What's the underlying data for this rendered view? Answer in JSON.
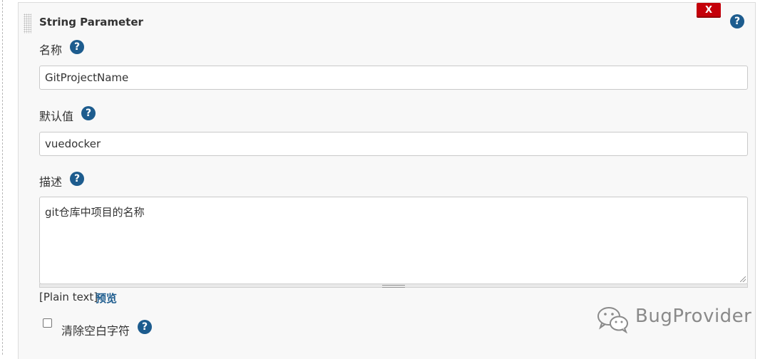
{
  "parameter": {
    "title": "String Parameter",
    "delete_label": "X",
    "help_glyph": "?"
  },
  "fields": {
    "name": {
      "label": "名称",
      "value": "GitProjectName"
    },
    "default_value": {
      "label": "默认值",
      "value": "vuedocker"
    },
    "description": {
      "label": "描述",
      "value": "git仓库中项目的名称"
    }
  },
  "markup": {
    "plain_text": "[Plain text]",
    "preview_link": "预览"
  },
  "trim": {
    "label": "清除空白字符",
    "checked": false
  },
  "watermark": {
    "text": "BugProvider"
  },
  "colors": {
    "help_icon": "#1d5c8e",
    "delete_button": "#c4000a",
    "link": "#1d5c8e",
    "panel_bg": "#f8f8f8"
  },
  "icons": [
    "drag-grip-icon",
    "help-icon",
    "close-icon",
    "wechat-icon"
  ]
}
